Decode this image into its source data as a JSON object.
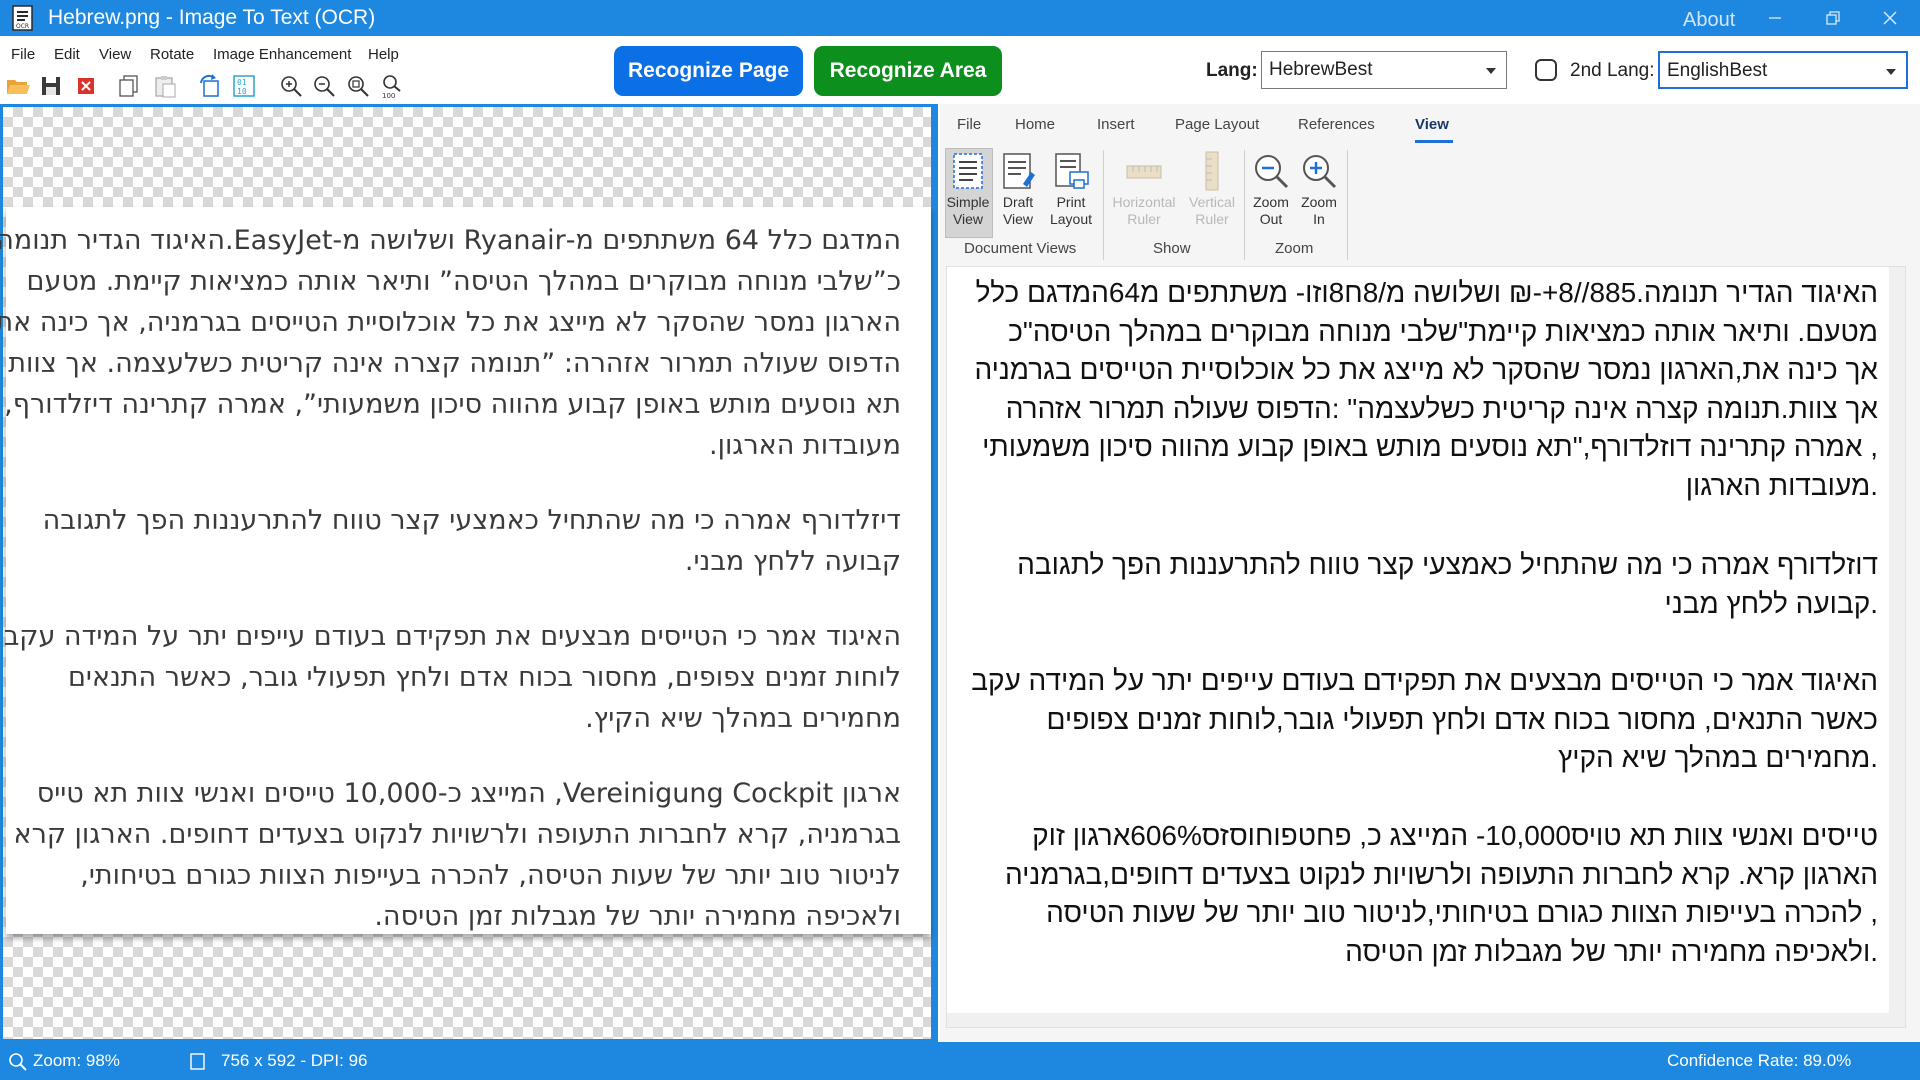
{
  "window": {
    "title": "Hebrew.png - Image To Text (OCR)",
    "about": "About",
    "accent": "#1e88e0"
  },
  "menu": [
    "File",
    "Edit",
    "View",
    "Rotate",
    "Image Enhancement",
    "Help"
  ],
  "toolbar_icons": [
    "open-folder-icon",
    "save-icon",
    "close-file-icon",
    "copy-icon",
    "paste-icon",
    "rotate-icon",
    "binary-icon",
    "zoom-in-icon",
    "zoom-out-icon",
    "zoom-fit-icon",
    "zoom-100-icon"
  ],
  "actions": {
    "recognize_page": "Recognize Page",
    "recognize_area": "Recognize Area",
    "recognize_page_color": "#0b6fe6",
    "recognize_area_color": "#0d8f1d"
  },
  "lang": {
    "label": "Lang:",
    "value": "HebrewBest",
    "second_label": "2nd Lang:",
    "second_checked": false,
    "second_value": "EnglishBest"
  },
  "image_text": {
    "p1": [
      "המדגם כלל 64 משתתפים מ-Ryanair ושלושה מ-EasyJet.האיגוד הגדיר תנומה",
      "כ”שלבי מנוחה מבוקרים במהלך הטיסה” ותיאר אותה כמציאות קיימת. מטעם",
      "הארגון נמסר שהסקר לא מייצג את כל אוכלוסיית הטייסים בגרמניה, אך כינה את",
      "הדפוס שעולה תמרור אזהרה: ”תנומה קצרה אינה קריטית כשלעצמה. אך צוות",
      "תא נוסעים מותש באופן קבוע מהווה סיכון משמעותי”, אמרה קתרינה דיזלדורף,",
      "מעובדות הארגון."
    ],
    "p2": [
      "דיזלדורף אמרה כי מה שהתחיל כאמצעי קצר טווח להתרעננות הפך לתגובה",
      "קבועה ללחץ מבני."
    ],
    "p3": [
      "האיגוד אמר כי הטייסים מבצעים את תפקידם בעודם עייפים יתר על המידה עקב",
      "לוחות זמנים צפופים, מחסור בכוח אדם ולחץ תפעולי גובר, כאשר התנאים",
      "מחמירים במהלך שיא הקיץ."
    ],
    "p4": [
      "ארגון Vereinigung Cockpit, המייצג כ-10,000 טייסים ואנשי צוות תא טייס",
      "בגרמניה, קרא לחברות התעופה ולרשויות לנקוט בצעדים דחופים. הארגון קרא",
      "לניטור טוב יותר של שעות הטיסה, להכרה בעייפות הצוות כגורם בטיחותי,",
      "ולאכיפה מחמירה יותר של מגבלות זמן הטיסה."
    ]
  },
  "ribbon": {
    "tabs": [
      "File",
      "Home",
      "Insert",
      "Page Layout",
      "References",
      "View"
    ],
    "active_tab": "View",
    "buttons": {
      "simple_view": [
        "Simple",
        "View"
      ],
      "draft_view": [
        "Draft",
        "View"
      ],
      "print_layout": [
        "Print",
        "Layout"
      ],
      "horizontal_ruler": [
        "Horizontal",
        "Ruler"
      ],
      "vertical_ruler": [
        "Vertical",
        "Ruler"
      ],
      "zoom_out": [
        "Zoom",
        "Out"
      ],
      "zoom_in": [
        "Zoom",
        "In"
      ]
    },
    "groups": [
      "Document Views",
      "Show",
      "Zoom"
    ]
  },
  "ocr_text": {
    "p1": [
      "האיגוד הגדיר תנומה.885//8+-₪ ושלושה מ/8ח8וזו- משתתפים מ64המדגם כלל",
      "מטעם. ותיאר אותה כמציאות קיימת\"שלבי מנוחה מבוקרים במהלך הטיסה\"כ",
      "אך כינה את,הארגון נמסר שהסקר לא מייצג את כל אוכלוסיית הטייסים בגרמניה",
      "אך צוות.תנומה קצרה אינה קריטית כשלעצמה\" :הדפוס שעולה תמרור אזהרה",
      ", אמרה קתרינה דוזלדורף,\"תא נוסעים מותש באופן קבוע מהווה סיכון משמעותי",
      ".מעובדות הארגון"
    ],
    "p2": [
      "דוזלדורף אמרה כי מה שהתחיל כאמצעי קצר טווח להתרעננות הפך לתגובה",
      ".קבועה ללחץ מבני"
    ],
    "p3": [
      "האיגוד אמר כי הטייסים מבצעים את תפקידם בעודם עייפים יתר על המידה עקב",
      "כאשר התנאים, מחסור בכוח אדם ולחץ תפעולי גובר,לוחות זמנים צפופים",
      ".מחמירים במהלך שיא הקיץ"
    ],
    "p4": [
      "טייסים ואנשי צוות תא טויס10,000- המייצג כ, פחטפוחוסזס606%ארגון זוק",
      "הארגון קרא. קרא לחברות התעופה ולרשויות לנקוט בצעדים דחופים,בגרמניה",
      ", להכרה בעייפות הצוות כגורם בטיחותי,לניטור טוב יותר של שעות הטיסה",
      ".ולאכיפה מחמירה יותר של מגבלות זמן הטיסה"
    ]
  },
  "status": {
    "zoom": "Zoom: 98%",
    "dimensions": "756 x 592 - DPI: 96",
    "confidence": "Confidence Rate: 89.0%"
  }
}
